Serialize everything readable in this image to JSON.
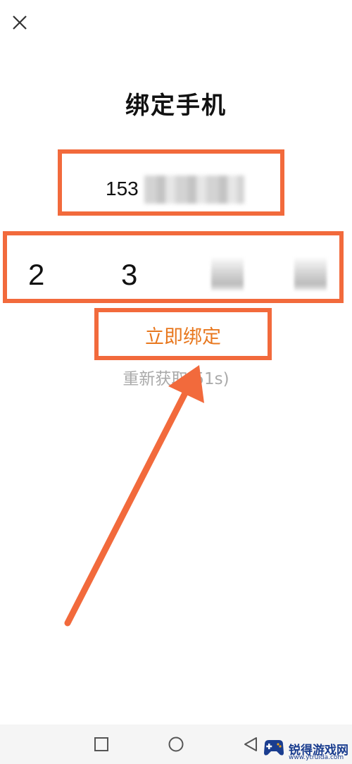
{
  "header": {
    "title": "绑定手机"
  },
  "phone": {
    "visible_prefix": "153"
  },
  "code": {
    "digits": [
      "2",
      "3"
    ]
  },
  "actions": {
    "bind_label": "立即绑定",
    "resend_label": "重新获取(51s)"
  },
  "watermark": {
    "name": "锐得游戏网",
    "url": "www.ytruida.com"
  },
  "colors": {
    "highlight": "#f26a3c",
    "bind_text": "#e8781f",
    "resend_text": "#aaaaaa"
  },
  "icons": {
    "close": "close-icon",
    "recent": "square-icon",
    "home": "circle-icon",
    "back": "triangle-back-icon"
  }
}
